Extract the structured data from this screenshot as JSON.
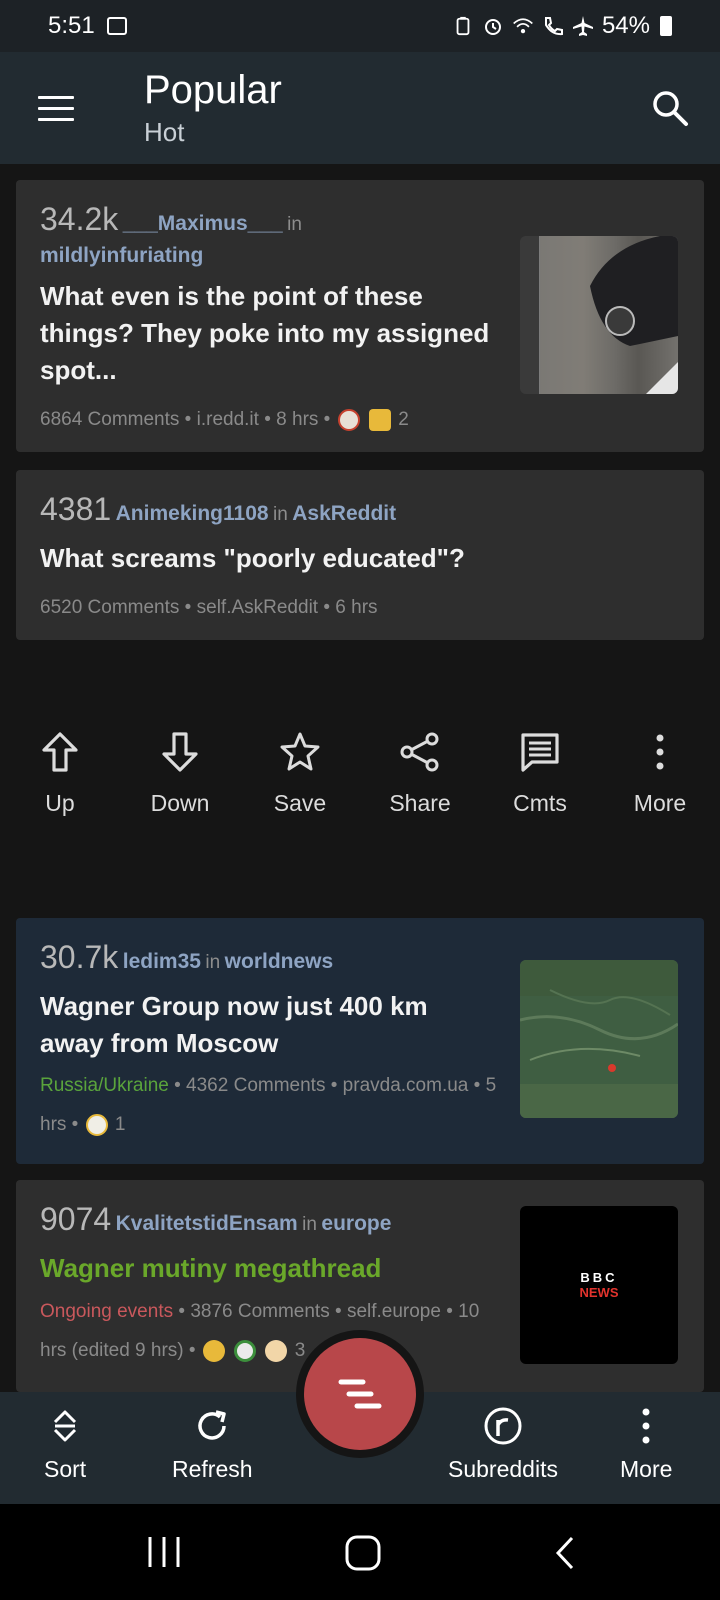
{
  "status_bar": {
    "time": "5:51",
    "battery": "54%"
  },
  "app_bar": {
    "title": "Popular",
    "subtitle": "Hot"
  },
  "posts": [
    {
      "score": "34.2k",
      "author": "___Maximus___",
      "in": "in",
      "subreddit": "mildlyinfuriating",
      "title": "What even is the point of these things? They poke into my assigned spot...",
      "comments": "6864 Comments",
      "domain": "i.redd.it",
      "age": "8 hrs",
      "award_count": "2"
    },
    {
      "score": "4381",
      "author": "Animeking1108",
      "in": "in",
      "subreddit": "AskReddit",
      "title": "What screams \"poorly educated\"?",
      "comments": "6520 Comments",
      "domain": "self.AskReddit",
      "age": "6 hrs"
    },
    {
      "score": "30.7k",
      "author": "ledim35",
      "in": "in",
      "subreddit": "worldnews",
      "title": "Wagner Group now just 400 km away from Moscow",
      "flair": "Russia/Ukraine",
      "comments": "4362 Comments",
      "domain": "pravda.com.ua",
      "age": "5 hrs",
      "award_count": "1"
    },
    {
      "score": "9074",
      "author": "KvalitetstidEnsam",
      "in": "in",
      "subreddit": "europe",
      "title": "Wagner mutiny megathread",
      "flair": "Ongoing events",
      "comments": "3876 Comments",
      "domain": "self.europe",
      "age_part1": "10",
      "age_part2": "hrs (edited 9 hrs)",
      "award_count": "3",
      "thumb_text_1": "BBC",
      "thumb_text_2": "NEWS"
    }
  ],
  "actions": [
    {
      "label": "Up",
      "icon": "arrow-up-icon"
    },
    {
      "label": "Down",
      "icon": "arrow-down-icon"
    },
    {
      "label": "Save",
      "icon": "star-icon"
    },
    {
      "label": "Share",
      "icon": "share-icon"
    },
    {
      "label": "Cmts",
      "icon": "comments-icon"
    },
    {
      "label": "More",
      "icon": "more-vertical-icon"
    }
  ],
  "bottom_bar": {
    "sort": "Sort",
    "refresh": "Refresh",
    "subreddits": "Subreddits",
    "more": "More"
  },
  "colors": {
    "accent": "#b8474a",
    "link": "#8ea4c3",
    "app_bar": "#222b31",
    "card": "#2e2e2e",
    "card_highlight": "#1e2a38"
  }
}
